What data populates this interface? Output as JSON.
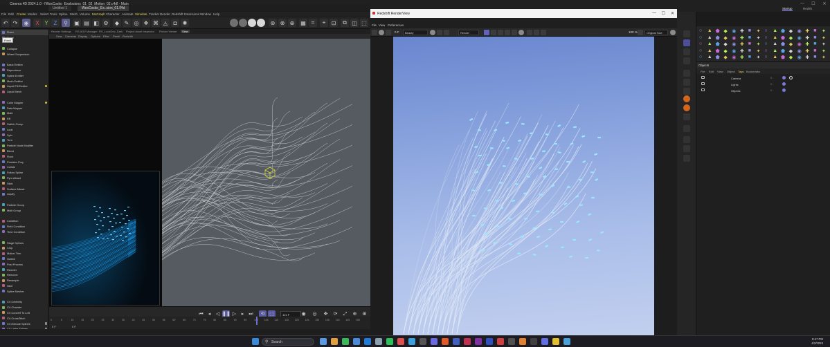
{
  "window": {
    "app_title": "Cinema 4D 2024.1.0 - [WesCosko_Explosions_01_02_Motion_02.c4d] - Main",
    "tabs": [
      "Untitled 1",
      "WesCosko_Ex..sion_01.c4d"
    ],
    "controls": [
      "—",
      "☐",
      "✕"
    ]
  },
  "menu": {
    "items": [
      "File",
      "Edit",
      "Create",
      "Modes",
      "Select",
      "Tools",
      "Spline",
      "Mesh",
      "Volume",
      "MoGraph",
      "Character",
      "Animate",
      "Simulate",
      "Tracker",
      "Render",
      "Redshift",
      "Extensions",
      "Window",
      "Help"
    ]
  },
  "left_panel": {
    "tooltip": "Fixed",
    "items": [
      "Fixed",
      "Fixed",
      "",
      "Collapse",
      "Wheel Suspension",
      "",
      "Basic Emitter",
      "Reproducer",
      "Spline Emitter",
      "Mesh Emitter",
      "Liquid Fill Emitter",
      "Liquid Mesh",
      "",
      "Color Mapper",
      "Data Mapper",
      "Math",
      "Kill",
      "Switch Group",
      "Look",
      "Spin",
      "Turn",
      "Particle Node Modifier",
      "Blend",
      "Flock",
      "Predator Prey",
      "Collide",
      "Follow Spline",
      "Pyro Attract",
      "Stick",
      "Surface Attract",
      "Liquify",
      "",
      "Particle Group",
      "Multi Group",
      "",
      "Condition",
      "Field Condition",
      "Time Condition",
      "",
      "Stage Splines",
      "Crop",
      "Motion Trim",
      "Outline",
      "Post Process",
      "Reorder",
      "Remover",
      "Resample",
      "Slice",
      "Spline Mesher",
      "",
      "CV-Celebrity",
      "CV-Chamfer",
      "CV-Convert To Loft",
      "CV-CrossStitch",
      "CV-Extrude Splines",
      "CV-Lathe Splines",
      "CV-Line",
      "CV-Load Splines to Objects Palette",
      "CV-Outline",
      "CV-Render Splines",
      "CV-Sweep Splines"
    ]
  },
  "viewport": {
    "tabs": [
      "Render Settings",
      "RS AOV Manager",
      "RS_LookDev_Dark",
      "Project Asset Inspector",
      "Picture Viewer",
      "View"
    ],
    "menu": [
      "View",
      "Cameras",
      "Display",
      "Options",
      "Filter",
      "Panel",
      "Redshift"
    ]
  },
  "timeline": {
    "ticks": [
      "0",
      "5",
      "10",
      "15",
      "20",
      "25",
      "30",
      "35",
      "40",
      "45",
      "50",
      "55",
      "60",
      "65",
      "70",
      "75",
      "80",
      "85",
      "90",
      "95",
      "100",
      "105",
      "110",
      "115",
      "120",
      "125",
      "130",
      "135",
      "140",
      "145",
      "150"
    ],
    "current_frame": "121 F",
    "start_frame": "0 F",
    "end_frame": "0 F"
  },
  "render_view": {
    "title": "Redshift RenderView",
    "menu": [
      "File",
      "View",
      "Preferences"
    ],
    "frame_label": "0 F",
    "beauty_dropdown": "Beauty",
    "aov_dropdown": "Render",
    "zoom": "100 %",
    "size_dropdown": "Original Size"
  },
  "right_dock": {
    "tabs": [
      "Startup",
      "Redsh"
    ],
    "objects_title": "Objects",
    "objects_menu": [
      "File",
      "Edit",
      "View",
      "Object",
      "Tags",
      "Bookmarks"
    ],
    "objects": [
      "Camera",
      "Lights",
      "Objects"
    ],
    "object_marks": "0 :",
    "palette_colors": [
      "#8f8fe6",
      "#d5d5d5",
      "#5aa2e0",
      "#b1ef5a",
      "#c86ad8",
      "#e0c85a"
    ]
  },
  "taskbar": {
    "search_placeholder": "Search",
    "time": "8:47 PM",
    "date": "4/2/2024"
  }
}
